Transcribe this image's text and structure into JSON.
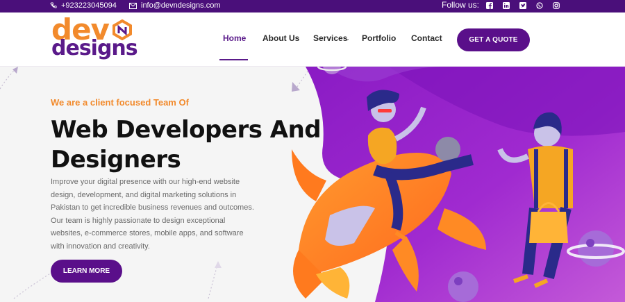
{
  "topbar": {
    "phone": "+923223045094",
    "email": "info@devndesigns.com",
    "follow_label": "Follow us:",
    "socials": [
      "facebook-icon",
      "linkedin-icon",
      "twitter-icon",
      "whatsapp-icon",
      "instagram-icon"
    ]
  },
  "logo": {
    "line1": "dev",
    "line2": "designs"
  },
  "nav": {
    "home": "Home",
    "about": "About Us",
    "services": "Services",
    "portfolio": "Portfolio",
    "contact": "Contact",
    "quote": "GET A QUOTE"
  },
  "hero": {
    "tagline": "We are a client focused Team Of",
    "headline_line1": "Web Developers And",
    "headline_line2": "Designers",
    "description": "Improve your digital presence with our high-end website design, development, and digital marketing solutions in Pakistan to get incredible business revenues and outcomes. Our team is highly passionate to design exceptional websites, e-commerce stores, mobile apps, and software with innovation and creativity.",
    "cta": "LEARN MORE"
  },
  "colors": {
    "brand_purple": "#5a0f8a",
    "brand_orange": "#f28a2c",
    "topbar": "#4a0f7a"
  }
}
